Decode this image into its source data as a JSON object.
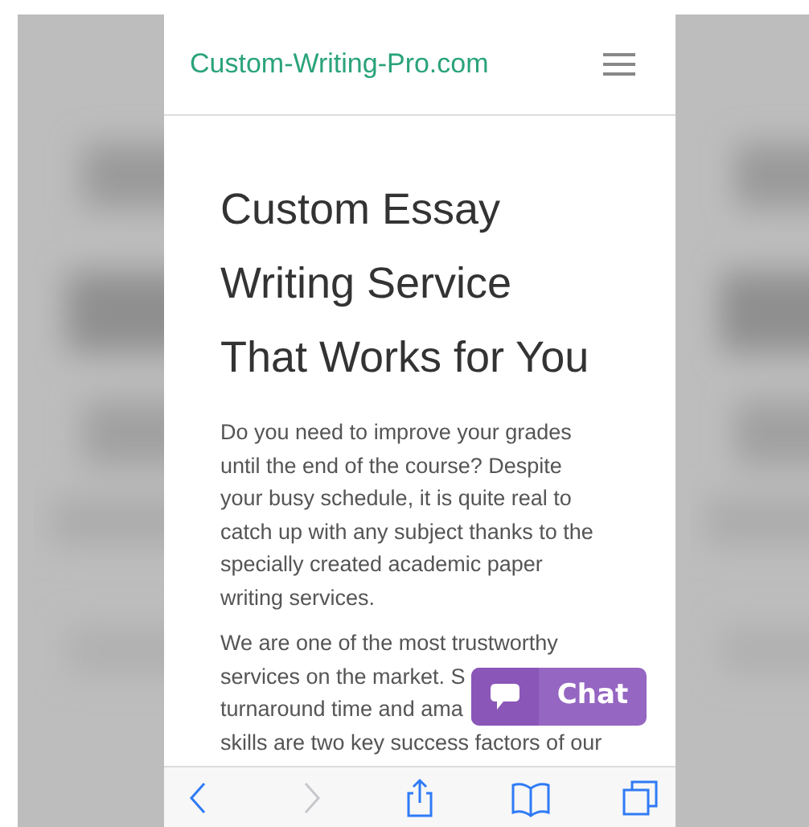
{
  "header": {
    "site_name": "Custom-Writing-Pro.com"
  },
  "heading_lines": [
    "Custom Essay",
    "Writing Service",
    "That Works for You"
  ],
  "paragraphs": [
    {
      "lines": [
        "Do you need to improve your grades",
        "until the end of the course? Despite",
        "your busy schedule, it is quite real to",
        "catch up with any subject thanks to the",
        "specially created academic paper",
        "writing services."
      ]
    },
    {
      "lines": [
        "We are one of the most trustworthy",
        "services on the market. S",
        "turnaround time and ama",
        "skills are two key success factors of our"
      ]
    }
  ],
  "chat_button": {
    "label": "Chat"
  },
  "toolbar": [
    {
      "kind": "back",
      "disabled": false
    },
    {
      "kind": "forward",
      "disabled": true
    },
    {
      "kind": "share",
      "disabled": false
    },
    {
      "kind": "bookmarks",
      "disabled": false
    },
    {
      "kind": "tabs",
      "disabled": false
    }
  ]
}
